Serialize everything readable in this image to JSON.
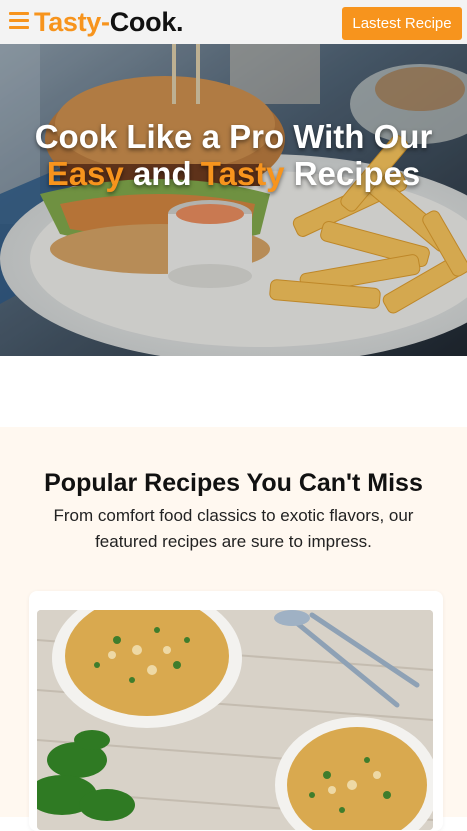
{
  "header": {
    "logo_part1": "Tasty-",
    "logo_part2": "Cook.",
    "cta_label": "Lastest Recipe",
    "menu_icon": "hamburger-menu-icon"
  },
  "hero": {
    "line1": "Cook Like a Pro With Our",
    "accent1": "Easy",
    "and_word": "and",
    "accent2": "Tasty",
    "tail_word": "Recipes",
    "image": "burger-and-fries-photo"
  },
  "popular": {
    "title": "Popular Recipes You Can't Miss",
    "subtitle": "From comfort food classics to exotic flavors, our featured recipes are sure to impress.",
    "card_image": "soup-bowls-photo"
  },
  "colors": {
    "accent": "#f7941d",
    "header_bg": "#f3f3f3",
    "section_bg": "#fff8f0"
  }
}
